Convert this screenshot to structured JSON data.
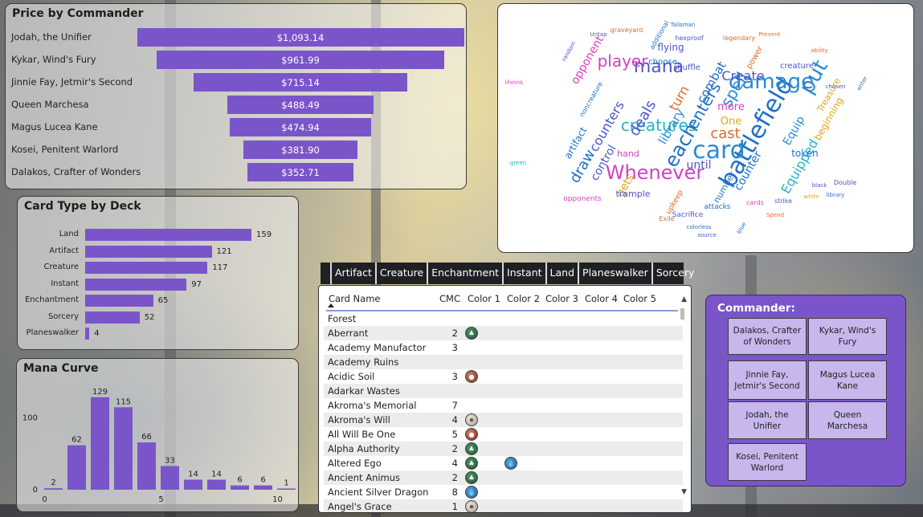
{
  "price_panel": {
    "title": "Price by Commander",
    "rows": [
      {
        "name": "Jodah, the Unifier",
        "value": 1093.14,
        "label": "$1,093.14"
      },
      {
        "name": "Kykar, Wind's Fury",
        "value": 961.99,
        "label": "$961.99"
      },
      {
        "name": "Jinnie Fay, Jetmir's Second",
        "value": 715.14,
        "label": "$715.14"
      },
      {
        "name": "Queen Marchesa",
        "value": 488.49,
        "label": "$488.49"
      },
      {
        "name": "Magus Lucea Kane",
        "value": 474.94,
        "label": "$474.94"
      },
      {
        "name": "Kosei, Penitent Warlord",
        "value": 381.9,
        "label": "$381.90"
      },
      {
        "name": "Dalakos, Crafter of Wonders",
        "value": 352.71,
        "label": "$352.71"
      }
    ]
  },
  "type_panel": {
    "title": "Card Type by Deck",
    "rows": [
      {
        "name": "Land",
        "value": 159
      },
      {
        "name": "Artifact",
        "value": 121
      },
      {
        "name": "Creature",
        "value": 117
      },
      {
        "name": "Instant",
        "value": 97
      },
      {
        "name": "Enchantment",
        "value": 65
      },
      {
        "name": "Sorcery",
        "value": 52
      },
      {
        "name": "Planeswalker",
        "value": 4
      }
    ]
  },
  "mana_panel": {
    "title": "Mana Curve"
  },
  "chart_data": {
    "type": "bar",
    "title": "Mana Curve",
    "x": [
      0,
      1,
      2,
      3,
      4,
      5,
      6,
      7,
      8,
      9,
      10
    ],
    "values": [
      2,
      62,
      129,
      115,
      66,
      33,
      14,
      14,
      6,
      6,
      1
    ],
    "y_ticks": [
      "0",
      "100"
    ],
    "x_ticks": [
      "0",
      "5",
      "10"
    ],
    "ylim": [
      0,
      140
    ]
  },
  "word_cloud": {
    "words": [
      {
        "t": "battlefield",
        "s": 30,
        "c": "#1b6fc8"
      },
      {
        "t": "card",
        "s": 30,
        "c": "#2a8ad4"
      },
      {
        "t": "Whenever",
        "s": 24,
        "c": "#d63fc3"
      },
      {
        "t": "damage",
        "s": 26,
        "c": "#2a8ad4"
      },
      {
        "t": "put",
        "s": 26,
        "c": "#2a8ad4"
      },
      {
        "t": "each",
        "s": 24,
        "c": "#1b6fc8"
      },
      {
        "t": "creatures",
        "s": 20,
        "c": "#23b2c4"
      },
      {
        "t": "mana",
        "s": 22,
        "c": "#4a55c8"
      },
      {
        "t": "player",
        "s": 20,
        "c": "#d63fc3"
      },
      {
        "t": "spell",
        "s": 20,
        "c": "#2a8ad4"
      },
      {
        "t": "enters",
        "s": 20,
        "c": "#1b6fc8"
      },
      {
        "t": "cast",
        "s": 18,
        "c": "#e06a2a"
      },
      {
        "t": "deals",
        "s": 18,
        "c": "#4a55c8"
      },
      {
        "t": "draw",
        "s": 18,
        "c": "#1b6fc8"
      },
      {
        "t": "counters",
        "s": 16,
        "c": "#4a55c8"
      },
      {
        "t": "Equipped",
        "s": 16,
        "c": "#23b2c4"
      },
      {
        "t": "turn",
        "s": 16,
        "c": "#e06a2a"
      },
      {
        "t": "library",
        "s": 15,
        "c": "#2a8ad4"
      },
      {
        "t": "Create",
        "s": 16,
        "c": "#4a55c8"
      },
      {
        "t": "combat",
        "s": 15,
        "c": "#1b6fc8"
      },
      {
        "t": "opponent",
        "s": 14,
        "c": "#d63fc3"
      },
      {
        "t": "Equip",
        "s": 14,
        "c": "#2a8ad4"
      },
      {
        "t": "counter",
        "s": 14,
        "c": "#1b6fc8"
      },
      {
        "t": "control",
        "s": 14,
        "c": "#4a55c8"
      },
      {
        "t": "until",
        "s": 14,
        "c": "#4a55c8"
      },
      {
        "t": "gets",
        "s": 14,
        "c": "#e0a81a"
      },
      {
        "t": "One",
        "s": 13,
        "c": "#e0a81a"
      },
      {
        "t": "more",
        "s": 13,
        "c": "#d63fc3"
      },
      {
        "t": "token",
        "s": 12,
        "c": "#1b6fc8"
      },
      {
        "t": "flying",
        "s": 12,
        "c": "#4a55c8"
      },
      {
        "t": "beginning",
        "s": 12,
        "c": "#e0a81a"
      },
      {
        "t": "artifact",
        "s": 12,
        "c": "#1b6fc8"
      },
      {
        "t": "trample",
        "s": 11,
        "c": "#4a55c8"
      },
      {
        "t": "number",
        "s": 11,
        "c": "#1b6fc8"
      },
      {
        "t": "hand",
        "s": 11,
        "c": "#d63fc3"
      },
      {
        "t": "Treasure",
        "s": 11,
        "c": "#e0a81a"
      },
      {
        "t": "creature",
        "s": 10,
        "c": "#4a55c8"
      },
      {
        "t": "power",
        "s": 10,
        "c": "#e06a2a"
      },
      {
        "t": "choose",
        "s": 10,
        "c": "#1b6fc8"
      },
      {
        "t": "shuffle",
        "s": 10,
        "c": "#4a55c8"
      },
      {
        "t": "upkeep",
        "s": 9,
        "c": "#e06a2a"
      },
      {
        "t": "attacks",
        "s": 9,
        "c": "#1b6fc8"
      },
      {
        "t": "Sacrifice",
        "s": 9,
        "c": "#4a55c8"
      },
      {
        "t": "opponents",
        "s": 9,
        "c": "#d63fc3"
      },
      {
        "t": "graveyard",
        "s": 8,
        "c": "#e06a2a"
      },
      {
        "t": "hexproof",
        "s": 8,
        "c": "#4a55c8"
      },
      {
        "t": "additional",
        "s": 8,
        "c": "#1b6fc8"
      },
      {
        "t": "legendary",
        "s": 8,
        "c": "#e06a2a"
      },
      {
        "t": "Double",
        "s": 8,
        "c": "#4a55c8"
      },
      {
        "t": "noncreature",
        "s": 8,
        "c": "#1b6fc8"
      },
      {
        "t": "Exile",
        "s": 8,
        "c": "#e06a2a"
      },
      {
        "t": "cards",
        "s": 8,
        "c": "#d63fc3"
      },
      {
        "t": "strike",
        "s": 8,
        "c": "#4a55c8"
      },
      {
        "t": "white",
        "s": 7,
        "c": "#e0a81a"
      },
      {
        "t": "black",
        "s": 7,
        "c": "#4a55c8"
      },
      {
        "t": "blue",
        "s": 7,
        "c": "#1b6fc8"
      },
      {
        "t": "green",
        "s": 7,
        "c": "#23b2c4"
      },
      {
        "t": "Prevent",
        "s": 7,
        "c": "#e06a2a"
      },
      {
        "t": "Talisman",
        "s": 7,
        "c": "#1b6fc8"
      },
      {
        "t": "Untap",
        "s": 7,
        "c": "#4a55c8"
      },
      {
        "t": "lifelink",
        "s": 7,
        "c": "#d63fc3"
      },
      {
        "t": "colorless",
        "s": 7,
        "c": "#1b6fc8"
      },
      {
        "t": "source",
        "s": 7,
        "c": "#4a55c8"
      },
      {
        "t": "Spend",
        "s": 7,
        "c": "#e06a2a"
      },
      {
        "t": "enter",
        "s": 7,
        "c": "#1b6fc8"
      },
      {
        "t": "chosen",
        "s": 7,
        "c": "#4a55c8"
      },
      {
        "t": "ability",
        "s": 7,
        "c": "#e06a2a"
      },
      {
        "t": "library",
        "s": 7,
        "c": "#1b6fc8"
      },
      {
        "t": "random",
        "s": 7,
        "c": "#4a55c8"
      }
    ]
  },
  "tabs": [
    "Artifact",
    "Creature",
    "Enchantment",
    "Instant",
    "Land",
    "Planeswalker",
    "Sorcery"
  ],
  "table": {
    "headers": [
      "Card Name",
      "CMC",
      "Color 1",
      "Color 2",
      "Color 3",
      "Color 4",
      "Color 5"
    ],
    "rows": [
      {
        "name": "Forest",
        "cmc": "",
        "c1": "",
        "c2": ""
      },
      {
        "name": "Aberrant",
        "cmc": "2",
        "c1": "G",
        "c2": ""
      },
      {
        "name": "Academy Manufactor",
        "cmc": "3",
        "c1": "",
        "c2": ""
      },
      {
        "name": "Academy Ruins",
        "cmc": "",
        "c1": "",
        "c2": ""
      },
      {
        "name": "Acidic Soil",
        "cmc": "3",
        "c1": "R",
        "c2": ""
      },
      {
        "name": "Adarkar Wastes",
        "cmc": "",
        "c1": "",
        "c2": ""
      },
      {
        "name": "Akroma's Memorial",
        "cmc": "7",
        "c1": "",
        "c2": ""
      },
      {
        "name": "Akroma's Will",
        "cmc": "4",
        "c1": "W",
        "c2": ""
      },
      {
        "name": "All Will Be One",
        "cmc": "5",
        "c1": "R",
        "c2": ""
      },
      {
        "name": "Alpha Authority",
        "cmc": "2",
        "c1": "G",
        "c2": ""
      },
      {
        "name": "Altered Ego",
        "cmc": "4",
        "c1": "G",
        "c2": "U"
      },
      {
        "name": "Ancient Animus",
        "cmc": "2",
        "c1": "G",
        "c2": ""
      },
      {
        "name": "Ancient Silver Dragon",
        "cmc": "8",
        "c1": "U",
        "c2": ""
      },
      {
        "name": "Angel's Grace",
        "cmc": "1",
        "c1": "W",
        "c2": ""
      }
    ]
  },
  "commander_slicer": {
    "title": "Commander:",
    "options": [
      "Dalakos, Crafter of Wonders",
      "Kykar, Wind's Fury",
      "Jinnie Fay, Jetmir's Second",
      "Magus Lucea Kane",
      "Jodah, the Unifier",
      "Queen Marchesa",
      "Kosei, Penitent Warlord"
    ]
  },
  "colors": {
    "bar": "#7a55c9",
    "slicer_bg": "#7a55c9",
    "slicer_btn": "#c7b7ec"
  }
}
